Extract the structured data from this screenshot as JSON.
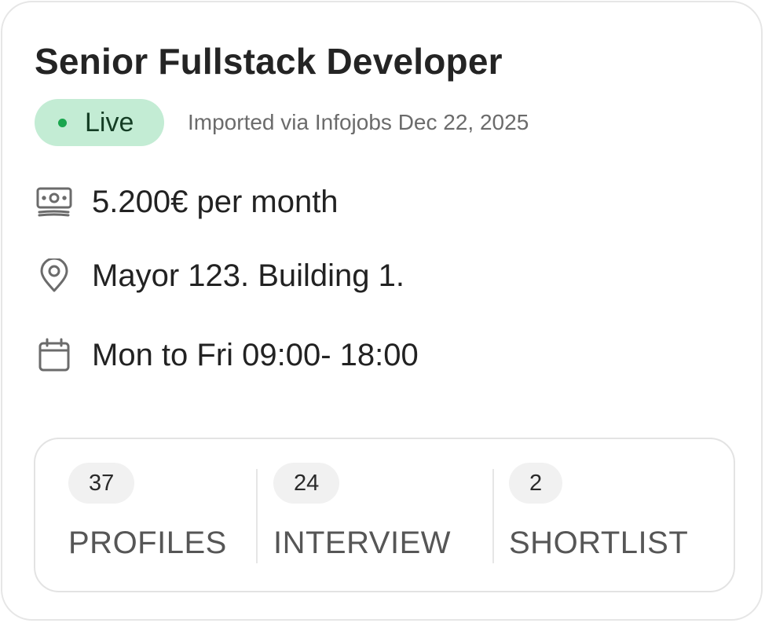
{
  "job": {
    "title": "Senior Fullstack Developer",
    "status": {
      "label": "Live",
      "color": "#1aa64e",
      "background": "#c3ecd4"
    },
    "import_note": "Imported via Infojobs Dec 22, 2025"
  },
  "details": {
    "salary": {
      "icon": "money-icon",
      "text": "5.200€ per month"
    },
    "location": {
      "icon": "location-pin-icon",
      "text": "Mayor 123. Building 1."
    },
    "schedule": {
      "icon": "calendar-icon",
      "text": "Mon to Fri 09:00- 18:00"
    }
  },
  "stats": {
    "profiles": {
      "count": "37",
      "label": "PROFILES"
    },
    "interview": {
      "count": "24",
      "label": "INTERVIEW"
    },
    "shortlist": {
      "count": "2",
      "label": "SHORTLIST"
    }
  }
}
